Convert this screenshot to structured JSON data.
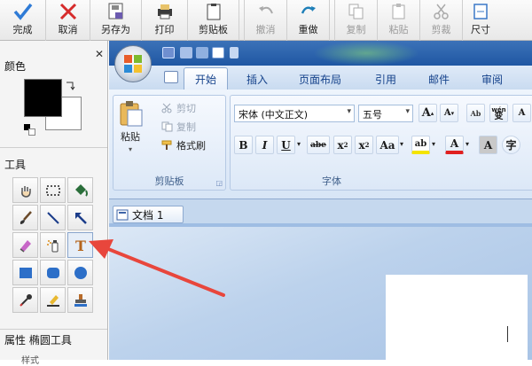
{
  "toolbar": {
    "buttons": [
      {
        "label": "完成",
        "icon": "check-icon"
      },
      {
        "label": "取消",
        "icon": "close-icon"
      },
      {
        "label": "另存为",
        "icon": "save-as-icon"
      },
      {
        "label": "打印",
        "icon": "print-icon"
      },
      {
        "label": "剪贴板",
        "icon": "clipboard-icon"
      },
      {
        "label": "撤消",
        "icon": "undo-icon"
      },
      {
        "label": "重做",
        "icon": "redo-icon"
      },
      {
        "label": "复制",
        "icon": "copy-icon"
      },
      {
        "label": "粘贴",
        "icon": "paste-icon"
      },
      {
        "label": "剪裁",
        "icon": "crop-icon"
      },
      {
        "label": "尺寸",
        "icon": "resize-icon"
      }
    ]
  },
  "left_panel": {
    "color_label": "颜色",
    "tools_label": "工具",
    "properties_label": "属性 椭圆工具",
    "bottom_label": "样式",
    "tools": [
      "hand-tool-icon",
      "select-rect-tool-icon",
      "fill-tool-icon",
      "brush-tool-icon",
      "line-tool-icon",
      "arrow-tool-icon",
      "eraser-tool-icon",
      "spray-tool-icon",
      "text-tool-icon",
      "rectangle-tool-icon",
      "rounded-rect-tool-icon",
      "ellipse-tool-icon",
      "eyedropper-tool-icon",
      "highlighter-tool-icon",
      "stamp-tool-icon"
    ]
  },
  "word": {
    "tabs": [
      "开始",
      "插入",
      "页面布局",
      "引用",
      "邮件",
      "审阅"
    ],
    "clipboard_group": {
      "label": "剪贴板",
      "paste": "粘贴",
      "cut": "剪切",
      "copy": "复制",
      "format_painter": "格式刷"
    },
    "font_group": {
      "label": "字体",
      "font_name": "宋体 (中文正文)",
      "font_size": "五号",
      "wen": "wén",
      "wen_char": "变",
      "grow": "A",
      "shrink": "A",
      "bold": "B",
      "italic": "I",
      "underline": "U",
      "strike": "abe",
      "subscript": "x",
      "superscript": "x",
      "sub_mark": "2",
      "sup_mark": "2",
      "change_case": "Aa",
      "highlight": "ab",
      "font_color": "A",
      "char_shading": "A"
    },
    "doc_tab": "文档 1"
  },
  "colors": {
    "primary": "#000000",
    "secondary": "#ffffff",
    "annotation_arrow": "#e8463c",
    "ribbon_text": "#15428b"
  }
}
